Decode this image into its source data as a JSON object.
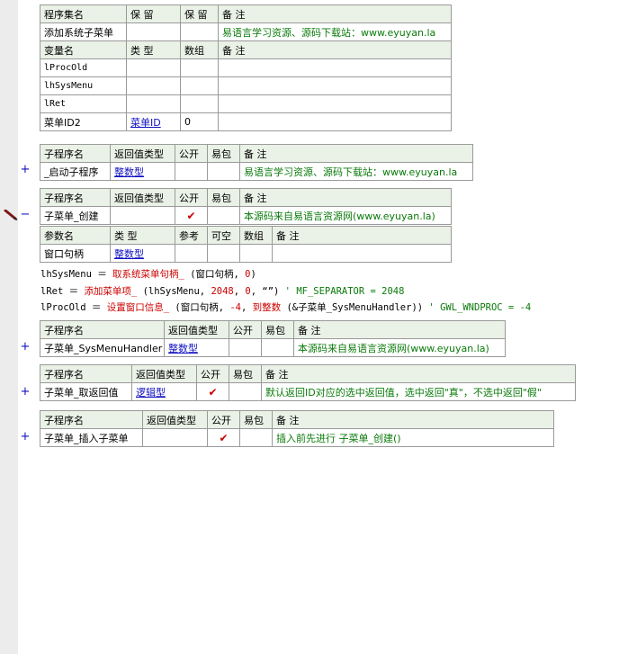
{
  "assembly": {
    "headers": [
      "程序集名",
      "保 留",
      "保 留",
      "备 注"
    ],
    "name": "添加系统子菜单",
    "remark": "易语言学习资源、源码下载站：www.eyuyan.la"
  },
  "variables": {
    "headers": [
      "变量名",
      "类 型",
      "数组",
      "备 注"
    ],
    "rows": [
      {
        "name": "lProcOld",
        "type": "",
        "array": ""
      },
      {
        "name": "lhSysMenu",
        "type": "",
        "array": ""
      },
      {
        "name": "lRet",
        "type": "",
        "array": ""
      },
      {
        "name": "菜单ID2",
        "type": "菜单ID",
        "array": "0"
      }
    ]
  },
  "sub_headers": {
    "name": "子程序名",
    "ret": "返回值类型",
    "public": "公开",
    "easy": "易包",
    "remark": "备 注"
  },
  "param_headers": {
    "name": "参数名",
    "type": "类 型",
    "ref": "参考",
    "optional": "可空",
    "array": "数组",
    "remark": "备 注"
  },
  "subs": [
    {
      "name": "_启动子程序",
      "ret": "整数型",
      "remark": "易语言学习资源、源码下载站：www.eyuyan.la",
      "expand": "+"
    },
    {
      "name": "子菜单_创建",
      "ret": "",
      "remark": "本源码来自易语言资源网(www.eyuyan.la)",
      "expand": "−",
      "param": {
        "name": "窗口句柄",
        "type": "整数型"
      }
    },
    {
      "name": "子菜单_SysMenuHandler",
      "ret": "整数型",
      "remark": "本源码来自易语言资源网(www.eyuyan.la)",
      "expand": "+"
    },
    {
      "name": "子菜单_取返回值",
      "ret": "逻辑型",
      "remark": "默认返回ID对应的选中返回值，选中返回\"真\"，不选中返回\"假\"",
      "expand": "+"
    },
    {
      "name": "子菜单_插入子菜单",
      "ret": "",
      "remark": "插入前先进行 子菜单_创建()",
      "expand": "+"
    }
  ],
  "checkmark": "✔",
  "code": {
    "line1": {
      "lhs": "lhSysMenu ＝ ",
      "fn": "取系统菜单句柄_",
      "args_a": " (窗口句柄, ",
      "num": "0",
      "args_b": ")"
    },
    "line2": {
      "lhs": "lRet ＝ ",
      "fn": "添加菜单项_",
      "args_a": " (lhSysMenu, ",
      "num_a": "2048",
      "mid": ", ",
      "num_b": "0",
      "args_b": ", “”) ",
      "comment": "' MF_SEPARATOR = 2048"
    },
    "line3": {
      "lhs": "lProcOld ＝ ",
      "fn": "设置窗口信息_",
      "args_a": " (窗口句柄, ",
      "num_a": "-4",
      "mid": ", ",
      "fn2": "到整数",
      "args_b": " (&子菜单_SysMenuHandler)) ",
      "comment": "' GWL_WNDPROC = -4"
    }
  }
}
